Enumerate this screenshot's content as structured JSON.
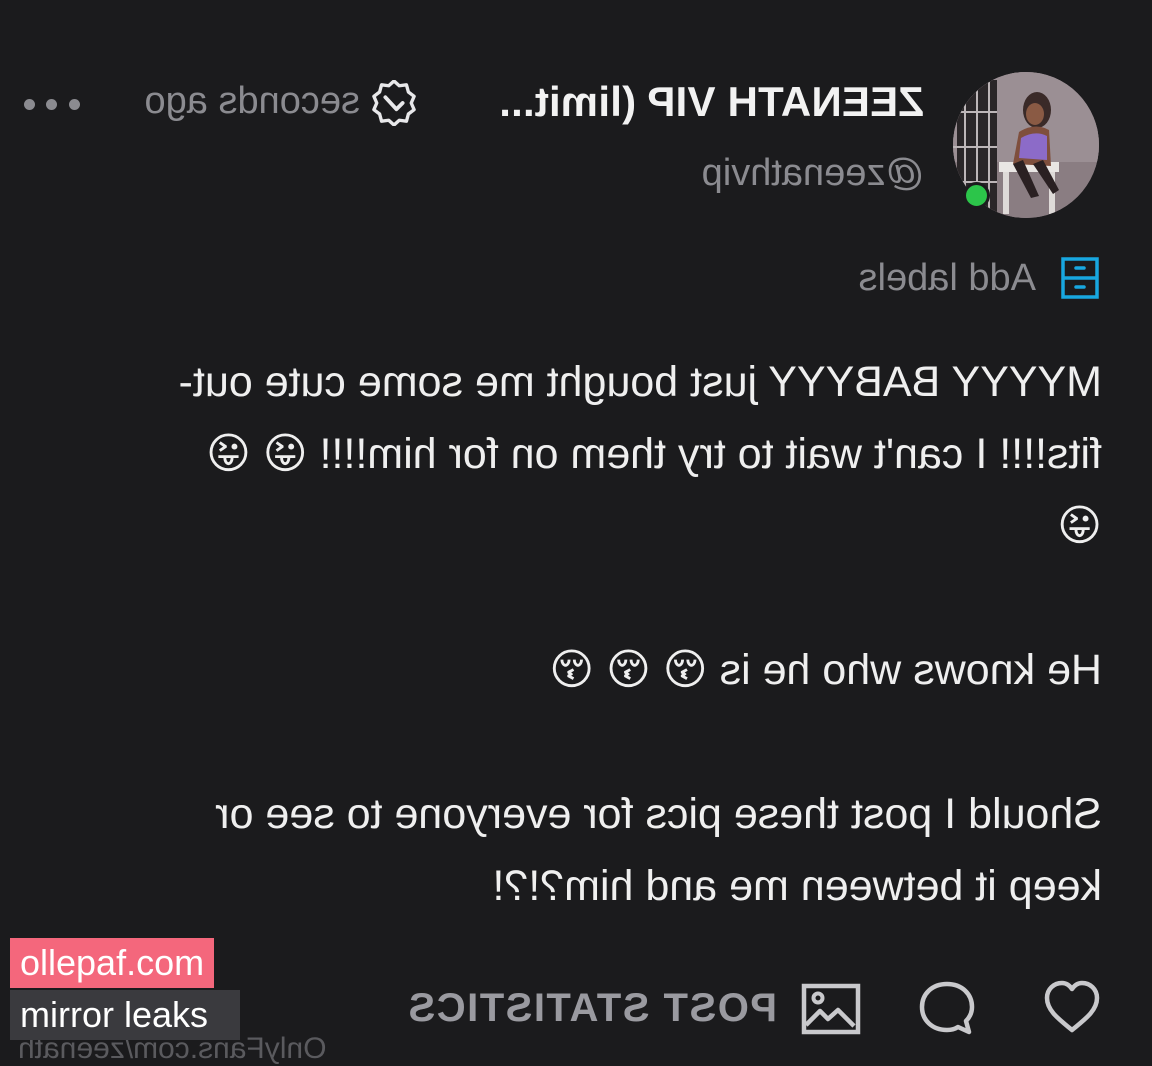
{
  "post": {
    "author": {
      "display_name": "ZEENATH VIP (limit...",
      "username": "@zeenathvip",
      "timestamp": "seconds ago",
      "online": true,
      "verified": true
    },
    "labels_action": "Add labels",
    "paragraphs": [
      "MYYYY BABYYY just bought me some cute out-\nfits!!!! I can't wait to try them on for him!!!! 😜 😜\n😜",
      "He knows who he is 😚 😚 😚",
      "Should I post these pics for everyone to see or\nkeep it between me and him?!?!"
    ],
    "actions": {
      "post_statistics": "POST STATISTICS"
    }
  },
  "icons": {
    "more": "more-icon",
    "verified": "verified-badge-icon",
    "labels": "labels-icon",
    "like": "heart-icon",
    "comment": "comment-icon",
    "stats": "image-stats-icon"
  },
  "colors": {
    "background": "#1b1b1d",
    "online": "#2cc54a",
    "accent": "#18a7e0",
    "watermark_pink": "#f4677c"
  },
  "watermark": {
    "site": "ollepaf.com",
    "tagline": "mirror leaks",
    "ghost": "OnlyFans.com/zeenath"
  }
}
